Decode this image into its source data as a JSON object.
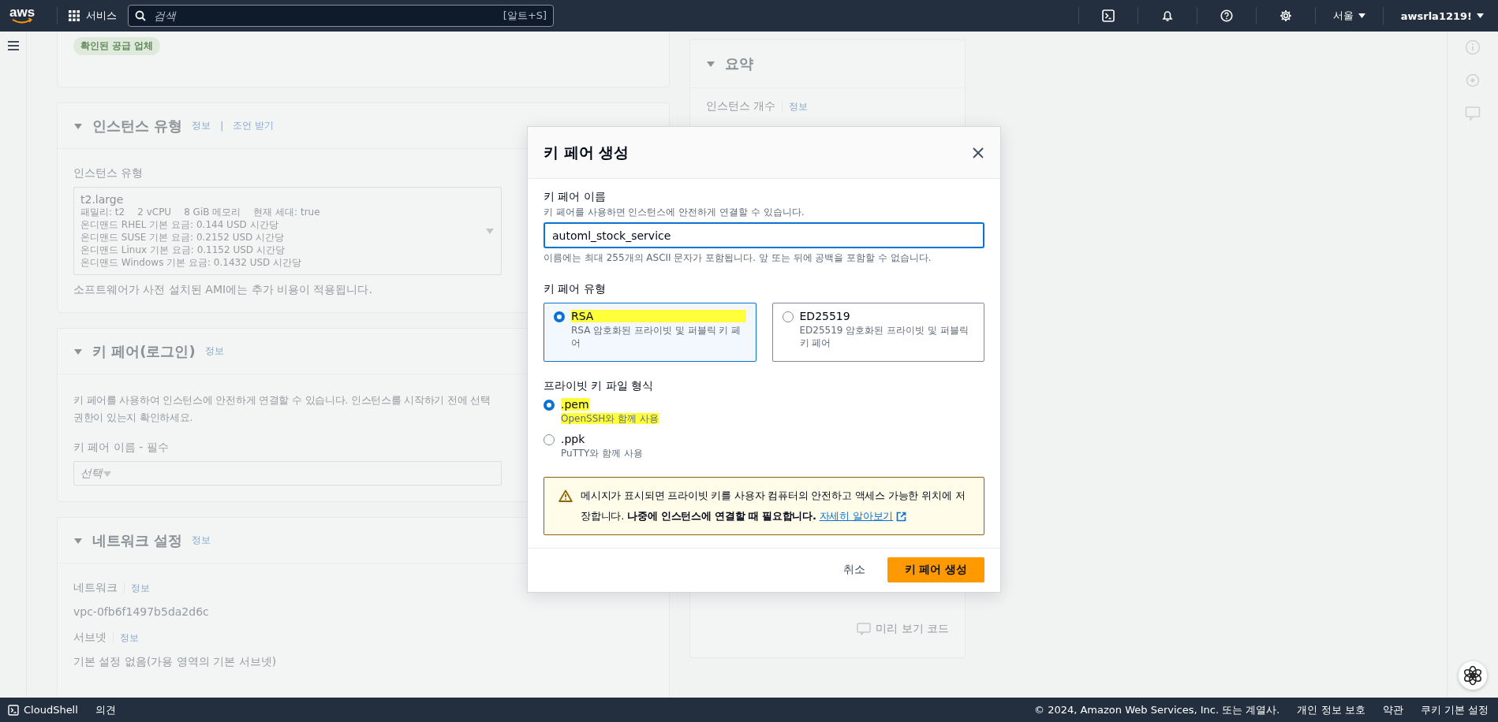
{
  "top_bar": {
    "logo": "aws",
    "services": "서비스",
    "search": {
      "placeholder": "검색",
      "shortcut": "[알트+S]"
    },
    "region": "서울",
    "account": "awsrla1219!"
  },
  "background": {
    "vendor_badge": "확인된 공급 업체",
    "instance_type": {
      "title": "인스턴스 유형",
      "expanded": true,
      "links": [
        "정보",
        "조언 받기"
      ],
      "link_separator": "|",
      "label": "인스턴스 유형",
      "selection": {
        "name": "t2.large",
        "specs": [
          "패밀리: t2",
          "2 vCPU",
          "8 GiB 메모리",
          "현재 세대: true"
        ],
        "prices": [
          "온디맨드 RHEL 기본 요금: 0.144 USD 시간당",
          "온디맨드 SUSE 기본 요금: 0.2152 USD 시간당",
          "온디맨드 Linux 기본 요금: 0.1152 USD 시간당",
          "온디맨드 Windows 기본 요금: 0.1432 USD 시간당"
        ]
      },
      "note": "소프트웨어가 사전 설치된 AMI에는 추가 비용이 적용됩니다."
    },
    "key_pair": {
      "title": "키 페어(로그인)",
      "expanded": true,
      "link": "정보",
      "description_lines": [
        "키 페어를 사용하여 인스턴스에 안전하게 연결할 수 있습니다. 인스턴스를 시작하기 전에 선택",
        "권한이 있는지 확인하세요."
      ],
      "label": "키 페어 이름 - 필수",
      "placeholder": "선택"
    },
    "network": {
      "title": "네트워크 설정",
      "expanded": true,
      "link": "정보",
      "fields": [
        {
          "label": "네트워크",
          "link": "정보",
          "value": "vpc-0fb6f1497b5da2d6c"
        },
        {
          "label": "서브넷",
          "link": "정보",
          "value": "기본 설정 없음(가용 영역의 기본 서브넷)"
        }
      ]
    },
    "summary": {
      "title": "요약",
      "expanded": true,
      "label": "인스턴스 개수",
      "link": "정보",
      "preview_code": "미리 보기 코드"
    }
  },
  "modal": {
    "title": "키 페어 생성",
    "name_field": {
      "label": "키 페어 이름",
      "description": "키 페어를 사용하면 인스턴스에 안전하게 연결할 수 있습니다.",
      "value": "automl_stock_service",
      "constraint": "이름에는 최대 255개의 ASCII 문자가 포함됩니다. 앞 또는 뒤에 공백을 포함할 수 없습니다."
    },
    "key_type": {
      "label": "키 페어 유형",
      "options": [
        {
          "title": "RSA",
          "description": "RSA 암호화된 프라이빗 및 퍼블릭 키 페어",
          "selected": true,
          "title_highlighted": true,
          "description_highlighted": false
        },
        {
          "title": "ED25519",
          "description": "ED25519 암호화된 프라이빗 및 퍼블릭 키 페어",
          "selected": false,
          "title_highlighted": false,
          "description_highlighted": false
        }
      ]
    },
    "file_format": {
      "label": "프라이빗 키 파일 형식",
      "options": [
        {
          "title": ".pem",
          "description": "OpenSSH와 함께 사용",
          "selected": true,
          "title_highlighted": true,
          "description_highlighted": true
        },
        {
          "title": ".ppk",
          "description": "PuTTY와 함께 사용",
          "selected": false,
          "title_highlighted": false,
          "description_highlighted": false
        }
      ]
    },
    "alert": {
      "text": "메시지가 표시되면 프라이빗 키를 사용자 컴퓨터의 안전하고 액세스 가능한 위치에 저장합니다. **나중에 인스턴스에 연결할 때 필요합니다.**",
      "link": "자세히 알아보기"
    },
    "buttons": {
      "cancel": "취소",
      "submit": "키 페어 생성"
    }
  },
  "footer": {
    "cloudshell": "CloudShell",
    "feedback": "의견",
    "copyright": "© 2024, Amazon Web Services, Inc. 또는 계열사.",
    "links": [
      "개인 정보 보호",
      "약관",
      "쿠키 기본 설정"
    ]
  }
}
